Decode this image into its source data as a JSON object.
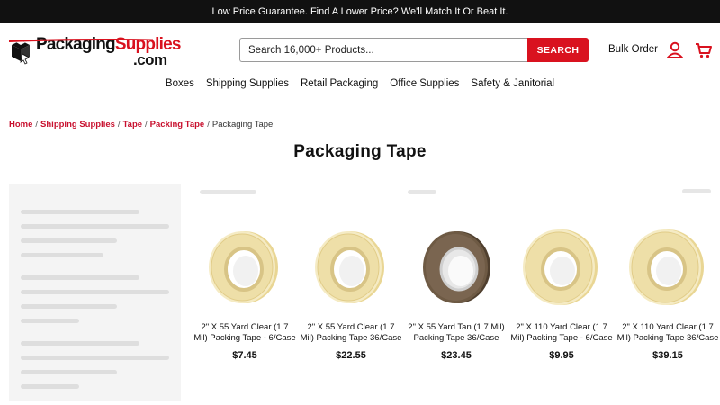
{
  "promo": "Low Price Guarantee. Find A Lower Price? We'll Match It Or Beat It.",
  "logo": {
    "text_main": "Packaging",
    "text_accent": "Supplies",
    "text_suffix": ".com"
  },
  "search": {
    "placeholder": "Search 16,000+ Products...",
    "button_label": "SEARCH"
  },
  "header": {
    "bulk_order": "Bulk Order",
    "account_icon": "user-icon",
    "cart_icon": "cart-icon"
  },
  "nav": [
    "Boxes",
    "Shipping Supplies",
    "Retail Packaging",
    "Office Supplies",
    "Safety & Janitorial"
  ],
  "breadcrumb": {
    "links": [
      "Home",
      "Shipping Supplies",
      "Tape",
      "Packing Tape"
    ],
    "current": "Packaging Tape",
    "separator": "/"
  },
  "page_title": "Packaging Tape",
  "colors": {
    "accent": "#d9121f",
    "clear_tape": "#efe0a8",
    "tan_tape": "#6e5a44"
  },
  "products": [
    {
      "name": "2\" X 55 Yard Clear (1.7 Mil) Packing Tape - 6/Case",
      "price": "$7.45",
      "color": "clear"
    },
    {
      "name": "2\" X 55 Yard Clear (1.7 Mil) Packing Tape 36/Case",
      "price": "$22.55",
      "color": "clear"
    },
    {
      "name": "2\" X 55 Yard Tan (1.7 Mil) Packing Tape 36/Case",
      "price": "$23.45",
      "color": "tan"
    },
    {
      "name": "2\" X 110 Yard Clear (1.7 Mil) Packing Tape - 6/Case",
      "price": "$9.95",
      "color": "clear"
    },
    {
      "name": "2\" X 110 Yard Clear (1.7 Mil) Packing Tape 36/Case",
      "price": "$39.15",
      "color": "clear"
    }
  ]
}
